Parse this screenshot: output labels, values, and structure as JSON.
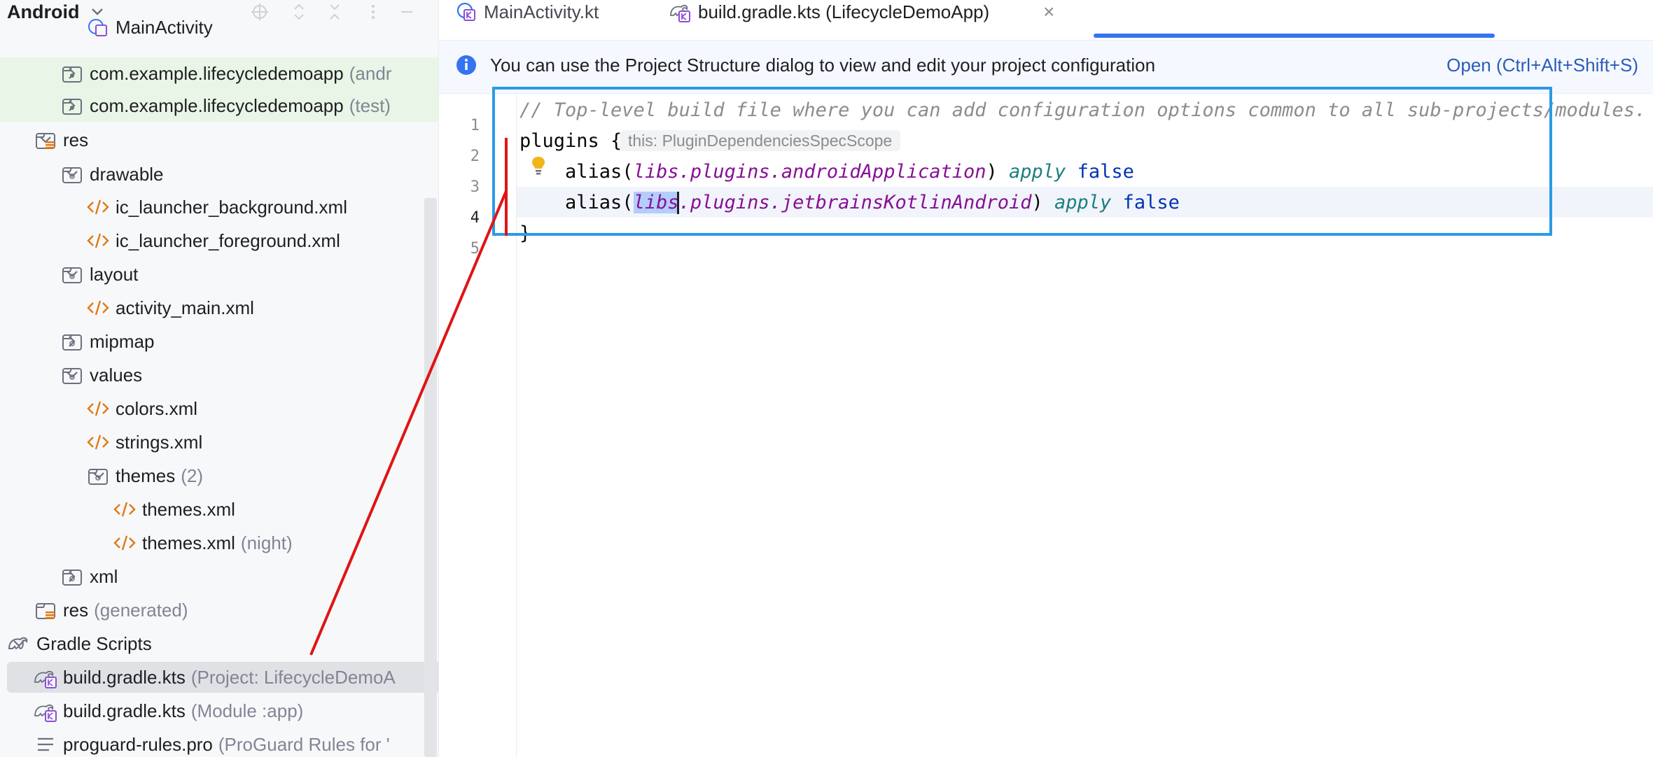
{
  "project_panel": {
    "title": "Android",
    "tree": [
      {
        "label": "MainActivity",
        "sub": "",
        "icon": "kotlin-activity-icon",
        "partial": true
      },
      {
        "label": "com.example.lifecycledemoapp",
        "sub": "(andr",
        "icon": "package-icon",
        "chevron": "right",
        "green": true
      },
      {
        "label": "com.example.lifecycledemoapp",
        "sub": "(test)",
        "icon": "package-icon",
        "chevron": "right",
        "green": true
      },
      {
        "label": "res",
        "sub": "",
        "icon": "resource-folder-icon",
        "chevron": "down"
      },
      {
        "label": "drawable",
        "sub": "",
        "icon": "folder-icon",
        "chevron": "down"
      },
      {
        "label": "ic_launcher_background.xml",
        "sub": "",
        "icon": "xml-file-icon"
      },
      {
        "label": "ic_launcher_foreground.xml",
        "sub": "",
        "icon": "xml-file-icon"
      },
      {
        "label": "layout",
        "sub": "",
        "icon": "folder-icon",
        "chevron": "down"
      },
      {
        "label": "activity_main.xml",
        "sub": "",
        "icon": "xml-file-icon"
      },
      {
        "label": "mipmap",
        "sub": "",
        "icon": "folder-icon",
        "chevron": "right"
      },
      {
        "label": "values",
        "sub": "",
        "icon": "folder-icon",
        "chevron": "down"
      },
      {
        "label": "colors.xml",
        "sub": "",
        "icon": "xml-file-icon"
      },
      {
        "label": "strings.xml",
        "sub": "",
        "icon": "xml-file-icon"
      },
      {
        "label": "themes",
        "sub": "(2)",
        "icon": "folder-icon",
        "chevron": "down"
      },
      {
        "label": "themes.xml",
        "sub": "",
        "icon": "xml-file-icon"
      },
      {
        "label": "themes.xml",
        "sub": "(night)",
        "icon": "xml-file-icon"
      },
      {
        "label": "xml",
        "sub": "",
        "icon": "folder-icon",
        "chevron": "right"
      },
      {
        "label": "res",
        "sub": "(generated)",
        "icon": "resource-folder-icon"
      },
      {
        "label": "Gradle Scripts",
        "sub": "",
        "icon": "gradle-icon",
        "chevron": "down"
      },
      {
        "label": "build.gradle.kts",
        "sub": "(Project: LifecycleDemoA",
        "icon": "gradle-kts-icon",
        "selected": true
      },
      {
        "label": "build.gradle.kts",
        "sub": "(Module :app)",
        "icon": "gradle-kts-icon"
      },
      {
        "label": "proguard-rules.pro",
        "sub": "(ProGuard Rules for '",
        "icon": "text-file-icon"
      }
    ]
  },
  "tabs": [
    {
      "label": "MainActivity.kt",
      "icon": "kotlin-activity-icon",
      "active": false
    },
    {
      "label": "build.gradle.kts (LifecycleDemoApp)",
      "icon": "gradle-kts-icon",
      "active": true,
      "close": "×"
    }
  ],
  "banner": {
    "text": "You can use the Project Structure dialog to view and edit your project configuration",
    "link": "Open (Ctrl+Alt+Shift+S)",
    "icon": "info-icon"
  },
  "editor": {
    "line_numbers": [
      "1",
      "2",
      "3",
      "4",
      "5"
    ],
    "lines": {
      "l1": "// Top-level build file where you can add configuration options common to all sub-projects/modules.",
      "l2_code": "plugins {",
      "l2_hint": "this: PluginDependenciesSpecScope",
      "l3_alias": "    alias(",
      "l3_libs": "libs",
      "l3_path": ".plugins.androidApplication",
      "l3_close": ") ",
      "l3_apply": "apply",
      "l3_space": " ",
      "l3_false": "false",
      "l4_alias": "    alias(",
      "l4_libs": "libs",
      "l4_path": ".plugins.jetbrainsKotlinAndroid",
      "l4_close": ") ",
      "l4_apply": "apply",
      "l4_space": " ",
      "l4_false": "false",
      "l5": "}"
    },
    "caret_line": "4"
  },
  "colors": {
    "annotation_box": "#2b9be6",
    "annotation_line": "#e01414",
    "accent": "#3574f0"
  }
}
